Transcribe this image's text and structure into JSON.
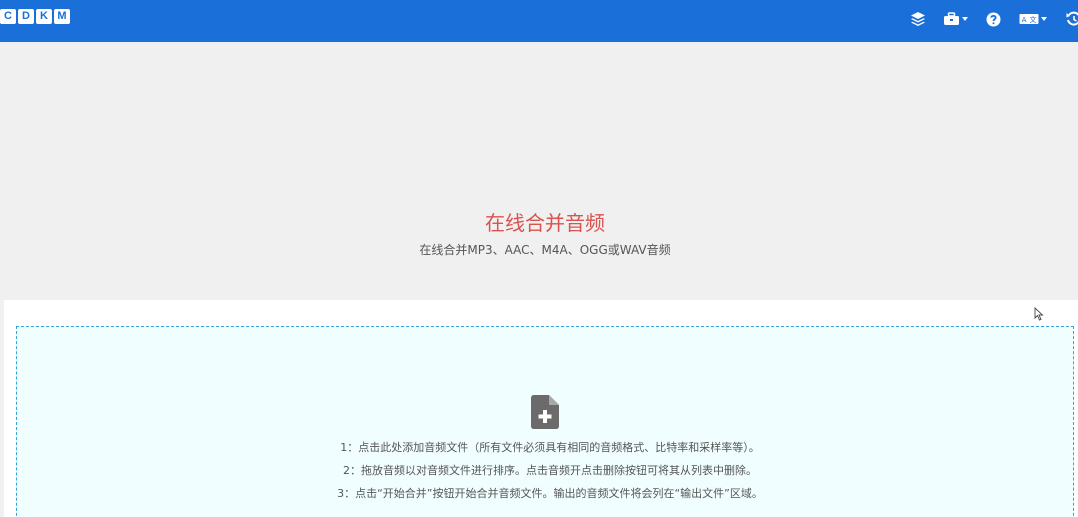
{
  "navbar": {
    "logo_letters": [
      "C",
      "D",
      "K",
      "M"
    ],
    "icons": [
      {
        "name": "layers-icon"
      },
      {
        "name": "toolbox-icon"
      },
      {
        "name": "help-icon"
      },
      {
        "name": "language-icon"
      },
      {
        "name": "history-icon"
      }
    ],
    "brand_color": "#1a6fd9"
  },
  "hero": {
    "title": "在线合并音频",
    "subtitle": "在线合并MP3、AAC、M4A、OGG或WAV音频",
    "title_color": "#d9534f"
  },
  "dropzone": {
    "steps": [
      "1：点击此处添加音频文件（所有文件必须具有相同的音频格式、比特率和采样率等）。",
      "2：拖放音频以对音频文件进行排序。点击音频开点击删除按钮可将其从列表中删除。",
      "3：点击“开始合并”按钮开始合并音频文件。输出的音频文件将会列在“输出文件”区域。"
    ],
    "border_color": "#36a3d9",
    "background": "#f0feff"
  }
}
